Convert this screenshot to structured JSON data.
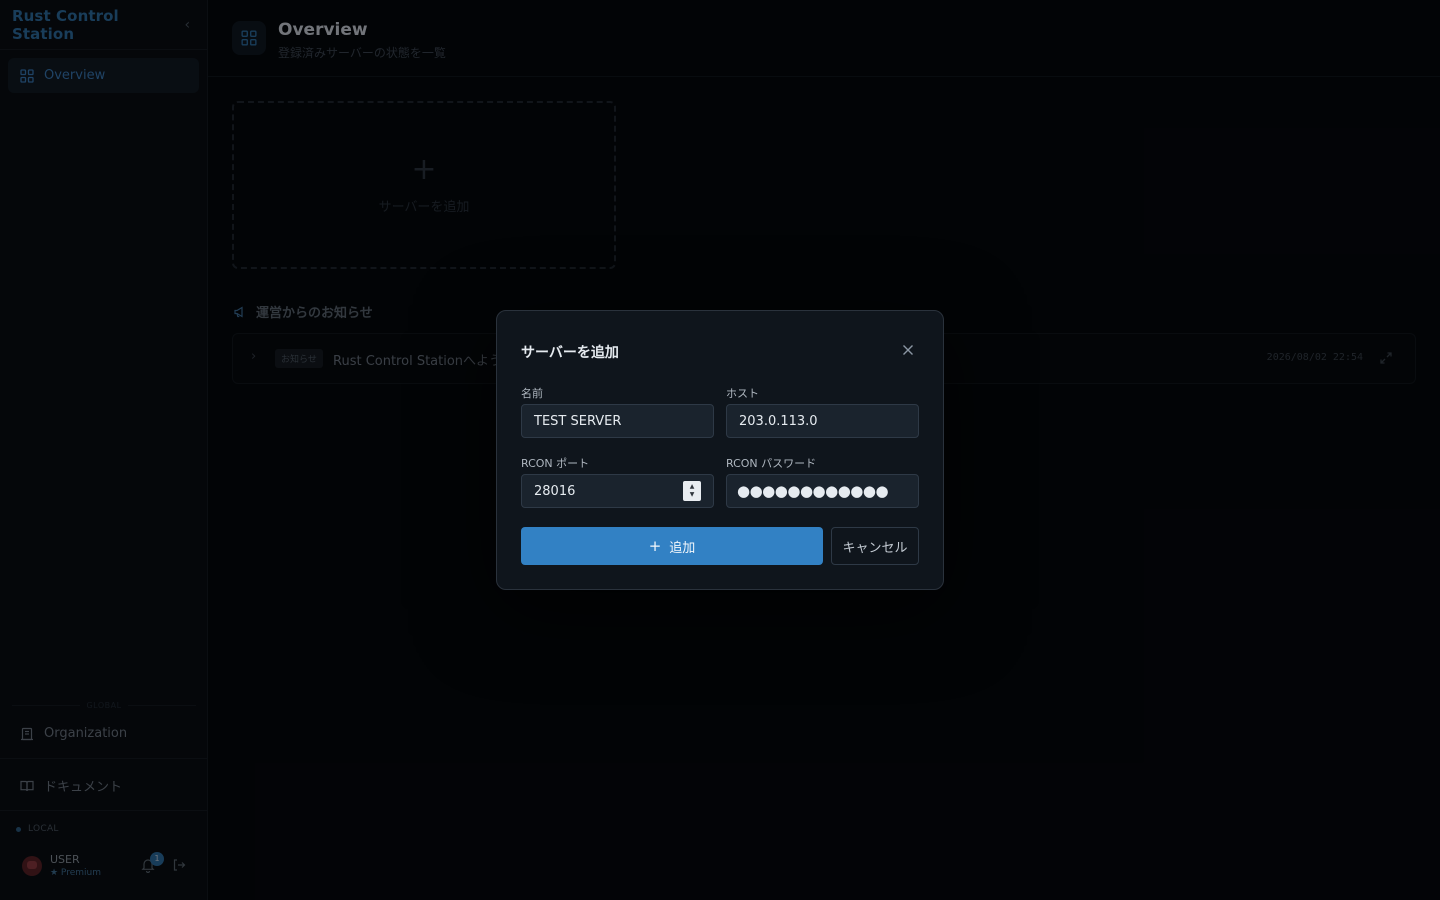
{
  "sidebar": {
    "brand": "Rust Control Station",
    "nav": [
      {
        "label": "Overview",
        "icon": "grid-icon"
      }
    ],
    "section_label": "GLOBAL",
    "links": [
      {
        "label": "Organization",
        "icon": "building-icon"
      },
      {
        "label": "ドキュメント",
        "icon": "book-icon"
      }
    ],
    "env_label": "LOCAL",
    "user": {
      "name": "USER",
      "plan": "★ Premium",
      "notifications": "1"
    }
  },
  "header": {
    "title": "Overview",
    "subtitle": "登録済みサーバーの状態を一覧"
  },
  "main": {
    "add_card": {
      "plus": "+",
      "label": "サーバーを追加"
    },
    "announcements": {
      "title": "運営からのお知らせ",
      "items": [
        {
          "tag": "お知らせ",
          "text": "Rust Control Stationへようこ",
          "date": "2026/08/02 22:54"
        }
      ]
    }
  },
  "modal": {
    "title": "サーバーを追加",
    "fields": {
      "name": {
        "label": "名前",
        "value": "TEST SERVER"
      },
      "host": {
        "label": "ホスト",
        "value": "203.0.113.0"
      },
      "port": {
        "label": "RCON ポート",
        "value": "28016"
      },
      "password": {
        "label": "RCON パスワード",
        "value": "●●●●●●●●●●●●"
      }
    },
    "add_button": "追加",
    "add_button_icon": "+",
    "cancel_button": "キャンセル"
  },
  "colors": {
    "accent": "#3281c4",
    "brand": "#2f6fa5",
    "background": "#05080c"
  }
}
